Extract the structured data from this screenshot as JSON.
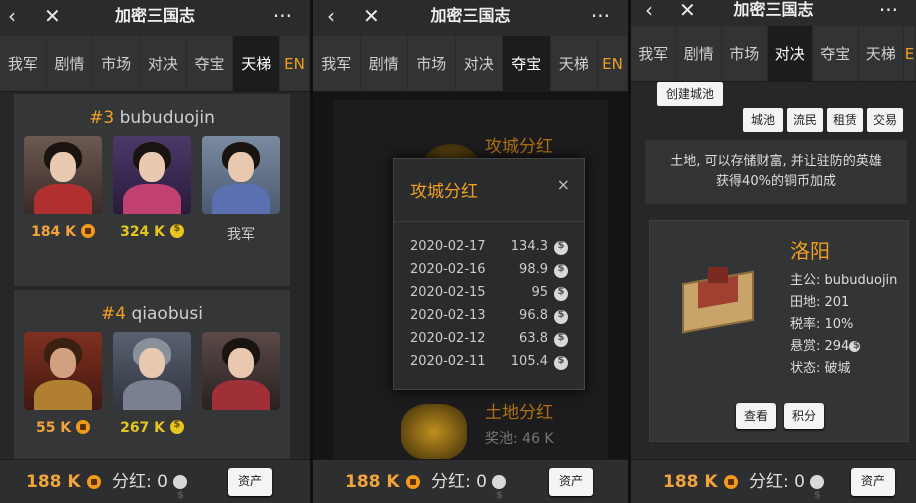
{
  "app": {
    "title": "加密三国志",
    "back_icon": "back-chevron",
    "close_icon": "close",
    "more_icon": "more-dots"
  },
  "colors": {
    "accent": "#f0a020",
    "coin_orange": "#f19a1c",
    "coin_yellow": "#e6c61e"
  },
  "panel1": {
    "tabs": [
      "我军",
      "剧情",
      "市场",
      "对决",
      "夺宝",
      "天梯",
      "EN"
    ],
    "active_tab": "天梯",
    "ranks": [
      {
        "num": "#3",
        "name": "bubuduojin",
        "vals": [
          "184 K",
          "324 K",
          "我军"
        ]
      },
      {
        "num": "#4",
        "name": "qiaobusi",
        "vals": [
          "55 K",
          "267 K"
        ]
      }
    ],
    "bottom": {
      "amount": "188 K",
      "dividend": "分红: 0",
      "assets": "资产"
    }
  },
  "panel2": {
    "tabs": [
      "我军",
      "剧情",
      "市场",
      "对决",
      "夺宝",
      "天梯",
      "EN"
    ],
    "active_tab": "夺宝",
    "bg_titles": {
      "top": "攻城分红",
      "bottom": "土地分红",
      "pool": "奖池: 46 K"
    },
    "modal": {
      "title": "攻城分红",
      "close": "×",
      "rows": [
        {
          "date": "2020-02-17",
          "value": "134.3"
        },
        {
          "date": "2020-02-16",
          "value": "98.9"
        },
        {
          "date": "2020-02-15",
          "value": "95"
        },
        {
          "date": "2020-02-13",
          "value": "96.8"
        },
        {
          "date": "2020-02-12",
          "value": "63.8"
        },
        {
          "date": "2020-02-11",
          "value": "105.4"
        }
      ]
    },
    "bottom": {
      "amount": "188 K",
      "dividend": "分红: 0",
      "assets": "资产"
    }
  },
  "panel3": {
    "tabs": [
      "我军",
      "剧情",
      "市场",
      "对决",
      "夺宝",
      "天梯",
      "E"
    ],
    "active_tab": "对决",
    "create_city": "创建城池",
    "subtabs": [
      "城池",
      "流民",
      "租赁",
      "交易"
    ],
    "info_line1": "土地, 可以存储财富, 并让驻防的英雄",
    "info_line2": "获得40%的铜币加成",
    "city": {
      "name": "洛阳",
      "lord": "主公: bubuduojin",
      "land": "田地: 201",
      "tax": "税率: 10%",
      "bounty": "悬赏: 294",
      "status": "状态: 破城",
      "view": "查看",
      "points": "积分"
    },
    "bottom": {
      "amount": "188 K",
      "dividend": "分红: 0",
      "assets": "资产"
    }
  }
}
